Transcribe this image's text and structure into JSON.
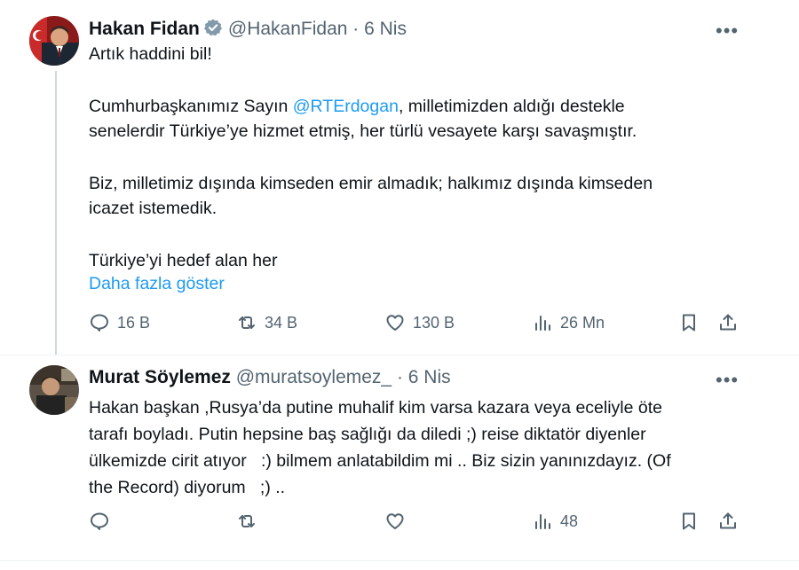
{
  "tweet1": {
    "name": "Hakan Fidan",
    "handle": "@HakanFidan",
    "separator": "·",
    "time": "6 Nis",
    "more": "•••",
    "lines": [
      "Artık haddini bil!",
      "",
      "Cumhurbaşkanımız Sayın ",
      "senelerdir Türkiye’ye hizmet etmiş, her türlü vesayete karşı savaşmıştır.",
      "",
      "Biz, milletimiz dışında kimseden emir almadık; halkımız dışında kimseden",
      "icazet istemedik.",
      "",
      "Türkiye’yi hedef alan her"
    ],
    "mention": "@RTErdogan",
    "mention_after": ", milletimizden aldığı destekle",
    "show_more": "Daha fazla göster",
    "replies": "16 B",
    "reposts": "34 B",
    "likes": "130 B",
    "views": "26 Mn",
    "verified_color": "#829aab",
    "link_color": "#1d9bf0"
  },
  "tweet2": {
    "name": "Murat Söylemez",
    "handle": "@muratsoylemez_",
    "separator": "·",
    "time": "6 Nis",
    "more": "•••",
    "lines": [
      "Hakan başkan ,Rusya’da putine muhalif kim varsa kazara veya eceliyle öte",
      "tarafı boyladı. Putin hepsine baş sağlığı da diledi ;) reise diktatör diyenler",
      "ülkemizde cirit atıyor   :) bilmem anlatabildim mi .. Biz sizin yanınızdayız. (Of",
      "the Record) diyorum   ;) .."
    ],
    "views": "48"
  }
}
